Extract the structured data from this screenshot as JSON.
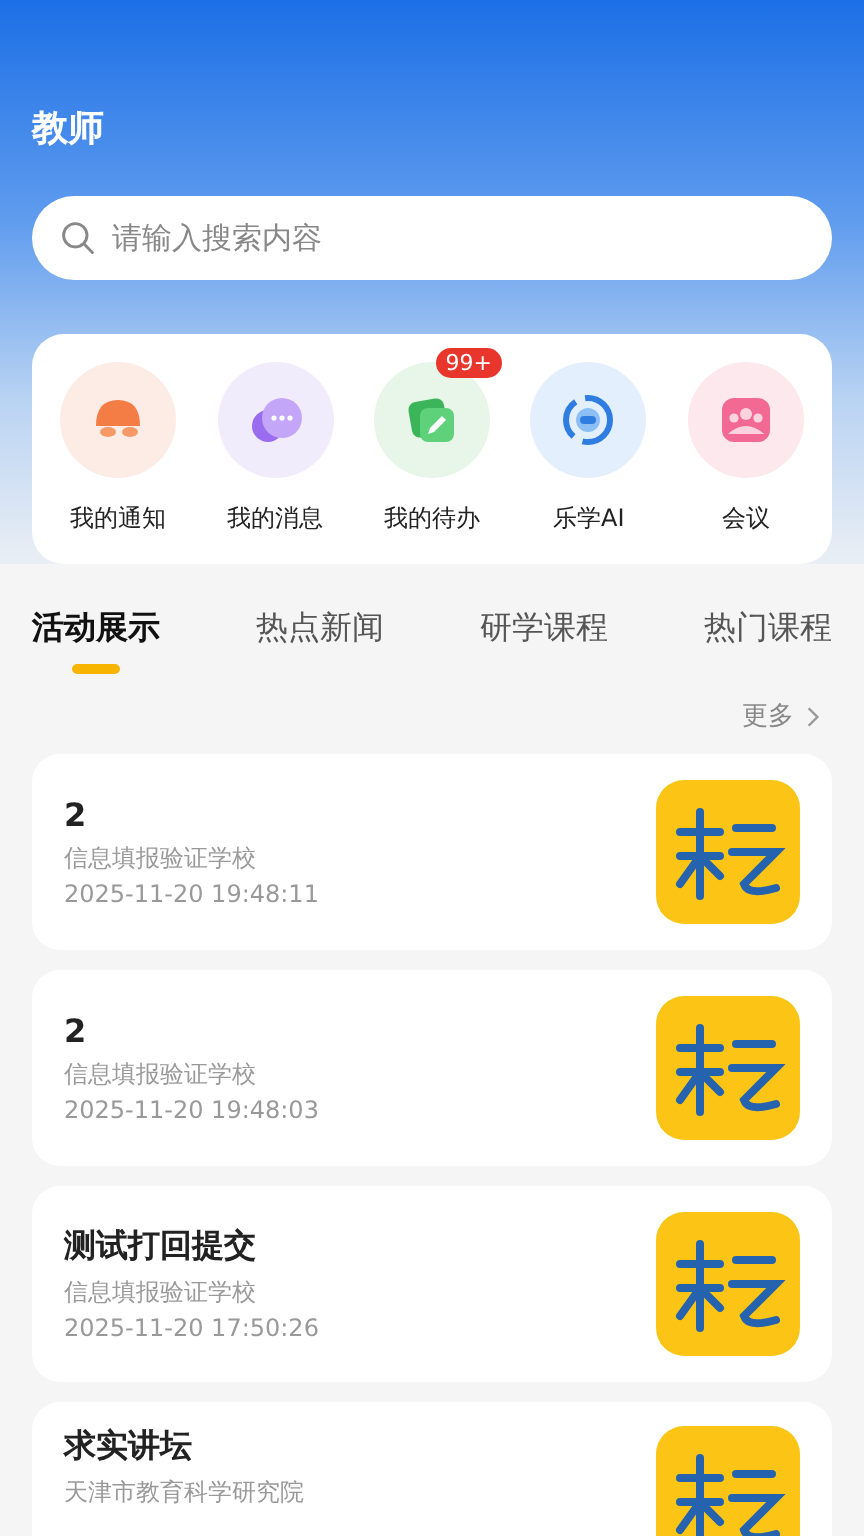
{
  "header": {
    "title": "教师"
  },
  "search": {
    "placeholder": "请输入搜索内容"
  },
  "shortcuts": [
    {
      "kind": "notice",
      "label": "我的通知"
    },
    {
      "kind": "message",
      "label": "我的消息"
    },
    {
      "kind": "todo",
      "label": "我的待办",
      "badge": "99+"
    },
    {
      "kind": "ai",
      "label": "乐学AI"
    },
    {
      "kind": "meeting",
      "label": "会议"
    }
  ],
  "tabs": [
    {
      "label": "活动展示",
      "selected": true
    },
    {
      "label": "热点新闻",
      "selected": false
    },
    {
      "label": "研学课程",
      "selected": false
    },
    {
      "label": "热门课程",
      "selected": false
    }
  ],
  "more": "更多",
  "items": [
    {
      "title": "2",
      "org": "信息填报验证学校",
      "time": "2025-11-20 19:48:11"
    },
    {
      "title": "2",
      "org": "信息填报验证学校",
      "time": "2025-11-20 19:48:03"
    },
    {
      "title": "测试打回提交",
      "org": "信息填报验证学校",
      "time": "2025-11-20 17:50:26"
    },
    {
      "title": "求实讲坛",
      "org": "天津市教育科学研究院"
    }
  ]
}
